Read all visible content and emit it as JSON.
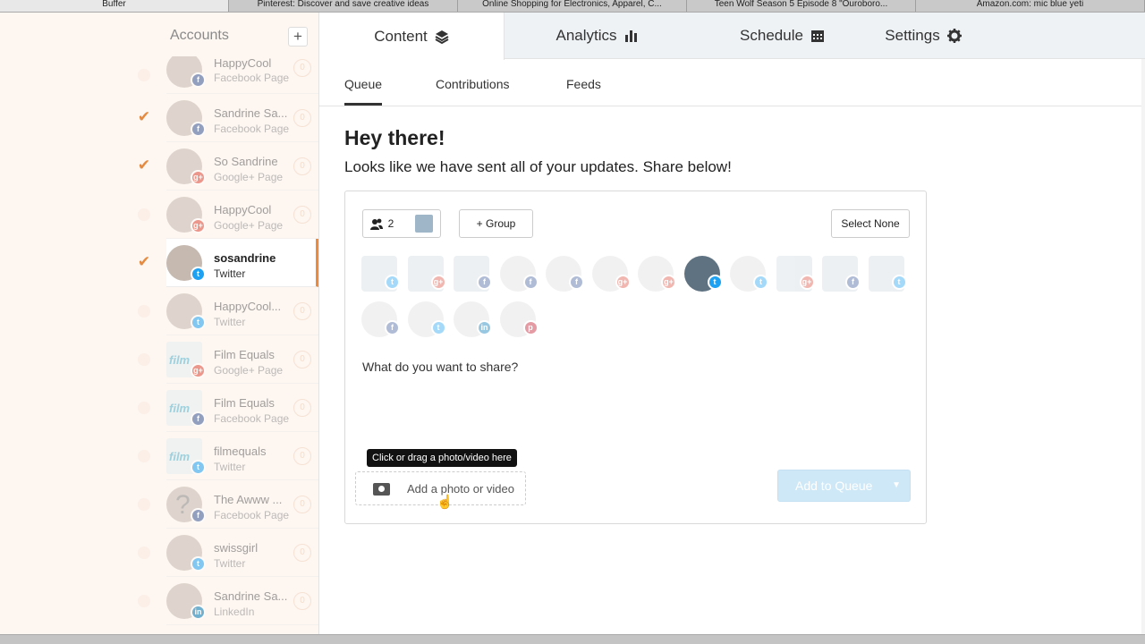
{
  "browser": {
    "tabs": [
      {
        "title": "Buffer"
      },
      {
        "title": "Pinterest: Discover and save creative ideas"
      },
      {
        "title": "Online Shopping for Electronics, Apparel, C..."
      },
      {
        "title": "Teen Wolf Season 5 Episode 8 \"Ouroboro..."
      },
      {
        "title": "Amazon.com: mic blue yeti"
      }
    ]
  },
  "sidebar": {
    "title": "Accounts",
    "add_label": "+",
    "accounts": [
      {
        "name": "HappyCool",
        "type": "Facebook Page",
        "count": "0",
        "service": "fb",
        "service_icon": "f"
      },
      {
        "name": "Sandrine Sa...",
        "type": "Facebook Page",
        "count": "0",
        "service": "fb",
        "service_icon": "f"
      },
      {
        "name": "So Sandrine",
        "type": "Google+ Page",
        "count": "0",
        "service": "gp",
        "service_icon": "g+"
      },
      {
        "name": "HappyCool",
        "type": "Google+ Page",
        "count": "0",
        "service": "gp",
        "service_icon": "g+"
      },
      {
        "name": "sosandrine",
        "type": "Twitter",
        "count": "",
        "service": "tw",
        "service_icon": "t"
      },
      {
        "name": "HappyCool...",
        "type": "Twitter",
        "count": "0",
        "service": "tw",
        "service_icon": "t"
      },
      {
        "name": "Film Equals",
        "type": "Google+ Page",
        "count": "0",
        "service": "gp",
        "service_icon": "g+"
      },
      {
        "name": "Film Equals",
        "type": "Facebook Page",
        "count": "0",
        "service": "fb",
        "service_icon": "f"
      },
      {
        "name": "filmequals",
        "type": "Twitter",
        "count": "0",
        "service": "tw",
        "service_icon": "t"
      },
      {
        "name": "The Awww ...",
        "type": "Facebook Page",
        "count": "0",
        "service": "fb",
        "service_icon": "f"
      },
      {
        "name": "swissgirl",
        "type": "Twitter",
        "count": "0",
        "service": "tw",
        "service_icon": "t"
      },
      {
        "name": "Sandrine Sa...",
        "type": "LinkedIn",
        "count": "0",
        "service": "li",
        "service_icon": "in"
      }
    ],
    "check_glyph": "✔"
  },
  "nav": {
    "content": "Content",
    "analytics": "Analytics",
    "schedule": "Schedule",
    "settings": "Settings"
  },
  "subnav": {
    "queue": "Queue",
    "contributions": "Contributions",
    "feeds": "Feeds"
  },
  "main": {
    "heading": "Hey there!",
    "subheading": "Looks like we have sent all of your updates. Share below!"
  },
  "composer": {
    "group_count": "2",
    "add_group": "+ Group",
    "select_none": "Select None",
    "placeholder": "What do you want to share?",
    "tooltip": "Click or drag a photo/video here",
    "add_photo": "Add a photo or video",
    "add_to_queue": "Add to Queue"
  },
  "colors": {
    "accent": "#ef8a3b",
    "facebook": "#3b5998",
    "twitter": "#1da1f2",
    "google": "#dd4b39",
    "linkedin": "#0077b5",
    "pinterest": "#bd081c",
    "queue_button": "#cfe8f7"
  }
}
